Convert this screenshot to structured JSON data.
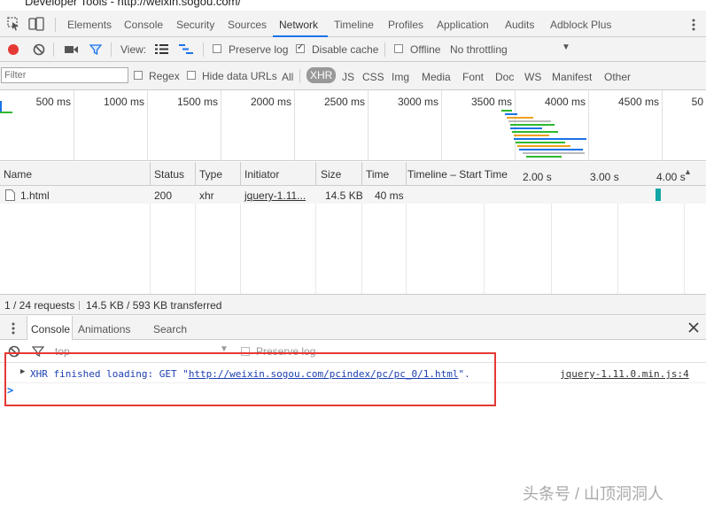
{
  "window": {
    "title": "Developer Tools - http://weixin.sogou.com/"
  },
  "tabs": [
    "Elements",
    "Console",
    "Security",
    "Sources",
    "Network",
    "Timeline",
    "Profiles",
    "Application",
    "Audits",
    "Adblock Plus"
  ],
  "active_tab": "Network",
  "toolbar": {
    "view_label": "View:",
    "preserve_log": "Preserve log",
    "disable_cache": "Disable cache",
    "offline": "Offline",
    "throttling": "No throttling"
  },
  "filter": {
    "placeholder": "Filter",
    "regex": "Regex",
    "hide_data_urls": "Hide data URLs",
    "types": [
      "All",
      "XHR",
      "JS",
      "CSS",
      "Img",
      "Media",
      "Font",
      "Doc",
      "WS",
      "Manifest",
      "Other"
    ],
    "active_type": "XHR"
  },
  "overview": {
    "ticks": [
      "500 ms",
      "1000 ms",
      "1500 ms",
      "2000 ms",
      "2500 ms",
      "3000 ms",
      "3500 ms",
      "4000 ms",
      "4500 ms",
      "50"
    ]
  },
  "table": {
    "columns": [
      "Name",
      "Status",
      "Type",
      "Initiator",
      "Size",
      "Time",
      "Timeline – Start Time"
    ],
    "timeline_ticks": [
      "2.00 s",
      "3.00 s",
      "4.00 s"
    ],
    "rows": [
      {
        "name": "1.html",
        "status": "200",
        "type": "xhr",
        "initiator": "jquery-1.11...",
        "size": "14.5 KB",
        "time": "40 ms"
      }
    ]
  },
  "status": {
    "requests": "1 / 24 requests",
    "transferred": "14.5 KB / 593 KB transferred"
  },
  "drawer": {
    "tabs": [
      "Console",
      "Animations",
      "Search"
    ],
    "context": "top",
    "preserve_log": "Preserve log"
  },
  "console": {
    "message_prefix": "XHR finished loading: GET \"",
    "message_url": "http://weixin.sogou.com/pcindex/pc/pc_0/1.html",
    "message_suffix": "\".",
    "source": "jquery-1.11.0.min.js:4",
    "prompt": ">"
  },
  "watermark": "头条号 / 山顶洞洞人",
  "colors": {
    "accent": "#1a73e8",
    "record_red": "#e53935",
    "highlight_box": "#e53935",
    "xhr_bar": "#14a6a6"
  }
}
